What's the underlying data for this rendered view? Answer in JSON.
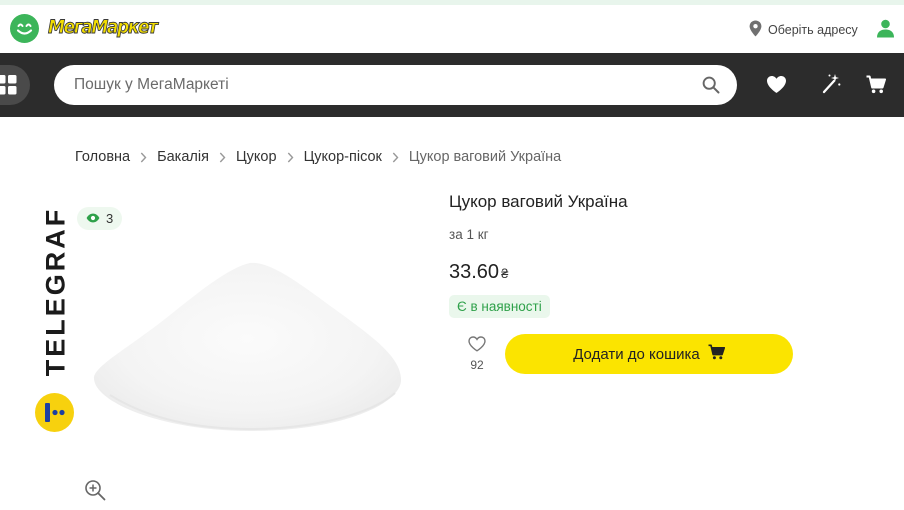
{
  "header": {
    "logo_text": "МегаМаркет",
    "address_label": "Оберіть адресу"
  },
  "search": {
    "placeholder": "Пошук у МегаМаркеті"
  },
  "breadcrumb": [
    "Головна",
    "Бакалія",
    "Цукор",
    "Цукор-пісок",
    "Цукор ваговий Україна"
  ],
  "gallery": {
    "views_count": "3",
    "watermark_text": "TELEGRAF"
  },
  "product": {
    "title": "Цукор ваговий Україна",
    "unit": "за 1 кг",
    "price": "33.60",
    "currency": "₴",
    "availability": "Є в наявності",
    "favorites_count": "92",
    "add_to_cart_label": "Додати до кошика"
  },
  "colors": {
    "brand_green": "#3cb55a",
    "brand_yellow": "#fbe400",
    "navbar_bg": "#2c2c2c",
    "stock_green": "#2fa14a"
  },
  "icons": [
    "smile-logo-icon",
    "location-pin-icon",
    "user-icon",
    "catalog-grid-icon",
    "search-icon",
    "heart-icon",
    "magic-wand-icon",
    "cart-icon",
    "chevron-right-icon",
    "eye-icon",
    "zoom-icon"
  ]
}
